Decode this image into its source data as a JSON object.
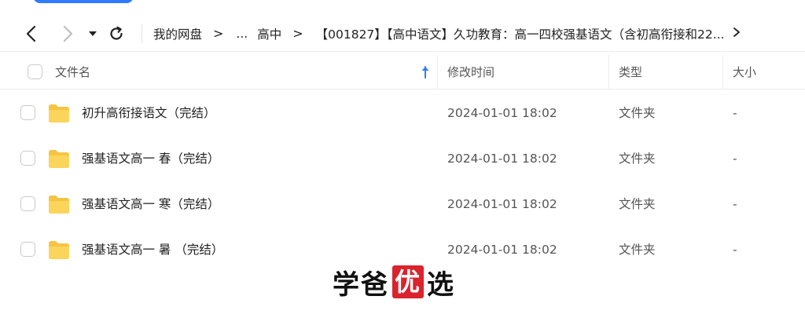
{
  "nav": {
    "icons": {
      "back": "chevron-left-icon",
      "forward": "chevron-right-icon",
      "dropdown": "caret-down-icon",
      "refresh": "refresh-icon"
    }
  },
  "breadcrumb": {
    "items": [
      {
        "label": "我的网盘"
      },
      {
        "label": "..."
      },
      {
        "label": "高中"
      },
      {
        "label": "【001827】【高中语文】久功教育：高一四校强基语文（含初高衔接和22..."
      }
    ],
    "separator": ">"
  },
  "table": {
    "columns": {
      "name": "文件名",
      "modified": "修改时间",
      "type": "类型",
      "size": "大小"
    },
    "sort_icon": "arrow-up-icon",
    "rows": [
      {
        "name": "初升高衔接语文（完结）",
        "modified": "2024-01-01 18:02",
        "type": "文件夹",
        "size": "-"
      },
      {
        "name": "强基语文高一 春（完结）",
        "modified": "2024-01-01 18:02",
        "type": "文件夹",
        "size": "-"
      },
      {
        "name": "强基语文高一 寒（完结）",
        "modified": "2024-01-01 18:02",
        "type": "文件夹",
        "size": "-"
      },
      {
        "name": "强基语文高一 暑 （完结）",
        "modified": "2024-01-01 18:02",
        "type": "文件夹",
        "size": "-"
      }
    ]
  },
  "watermark": {
    "text_before": "学爸",
    "seal": "优",
    "text_after": "选"
  },
  "colors": {
    "accent": "#2f7bff",
    "folder": "#f6c443",
    "seal": "#d9232d"
  }
}
